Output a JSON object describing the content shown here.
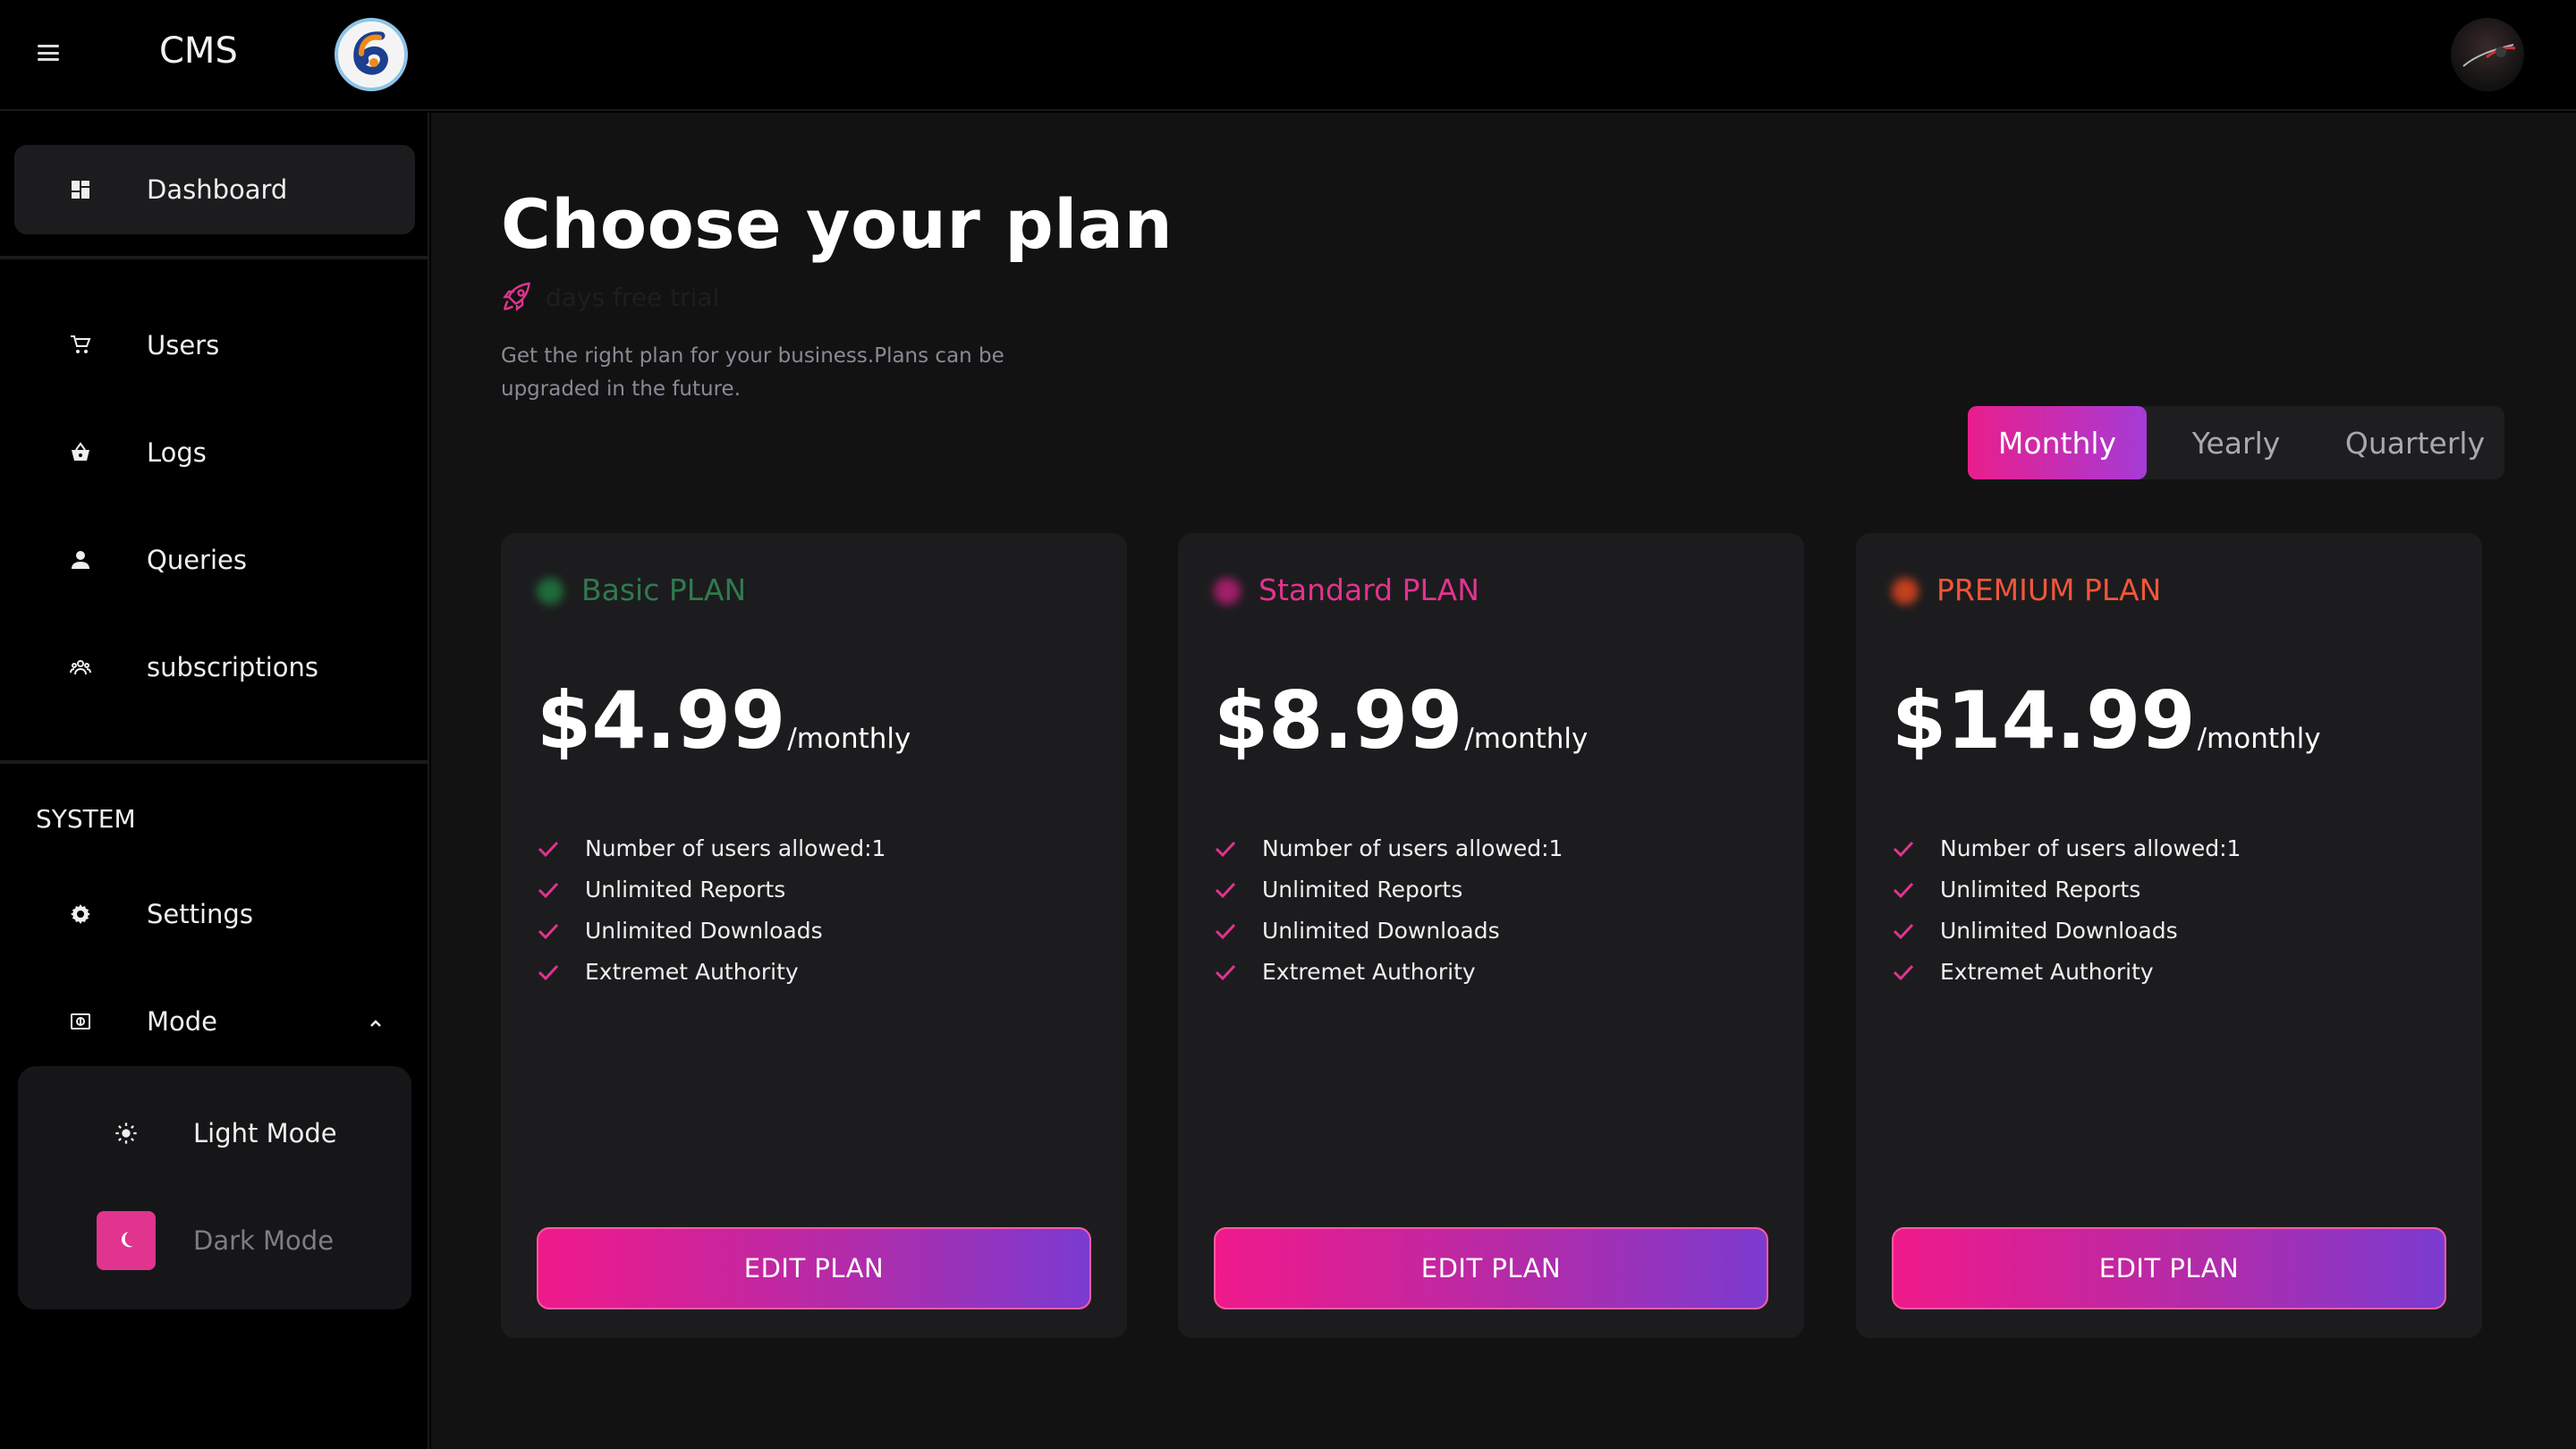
{
  "topbar": {
    "brand": "CMS",
    "menu_icon": "hamburger-icon",
    "logo": "app-logo",
    "avatar": "user-avatar"
  },
  "sidebar": {
    "items": [
      {
        "label": "Dashboard",
        "icon": "dashboard-icon",
        "active": true
      },
      {
        "label": "Users",
        "icon": "cart-icon"
      },
      {
        "label": "Logs",
        "icon": "basket-icon"
      },
      {
        "label": "Queries",
        "icon": "person-icon"
      },
      {
        "label": "subscriptions",
        "icon": "group-icon"
      }
    ],
    "system_title": "SYSTEM",
    "system_items": [
      {
        "label": "Settings",
        "icon": "gear-icon"
      },
      {
        "label": "Mode",
        "icon": "mode-icon",
        "expanded": true
      }
    ],
    "mode_options": [
      {
        "label": "Light Mode",
        "icon": "sun-icon"
      },
      {
        "label": "Dark Mode",
        "icon": "moon-icon",
        "selected": true
      }
    ]
  },
  "main": {
    "title": "Choose your plan",
    "trial_text": "days free trial",
    "subtitle": "Get the right plan for your business.Plans can be upgraded in the future.",
    "billing": {
      "options": [
        "Monthly",
        "Yearly",
        "Quarterly"
      ],
      "selected": "Monthly"
    },
    "plans": [
      {
        "name": "Basic PLAN",
        "color": "#2f7a4e",
        "dot_color": "#1f6b3a",
        "price": "$4.99",
        "period": "/monthly",
        "features": [
          "Number of users allowed:1",
          "Unlimited Reports",
          "Unlimited Downloads",
          "Extremet Authority"
        ],
        "button": "EDIT PLAN"
      },
      {
        "name": "Standard PLAN",
        "color": "#e2338f",
        "dot_color": "#a01e6a",
        "price": "$8.99",
        "period": "/monthly",
        "features": [
          "Number of users allowed:1",
          "Unlimited Reports",
          "Unlimited Downloads",
          "Extremet Authority"
        ],
        "button": "EDIT PLAN"
      },
      {
        "name": "PREMIUM PLAN",
        "color": "#f0563a",
        "dot_color": "#c2401e",
        "price": "$14.99",
        "period": "/monthly",
        "features": [
          "Number of users allowed:1",
          "Unlimited Reports",
          "Unlimited Downloads",
          "Extremet Authority"
        ],
        "button": "EDIT PLAN"
      }
    ],
    "accent": "#e91e8c"
  }
}
